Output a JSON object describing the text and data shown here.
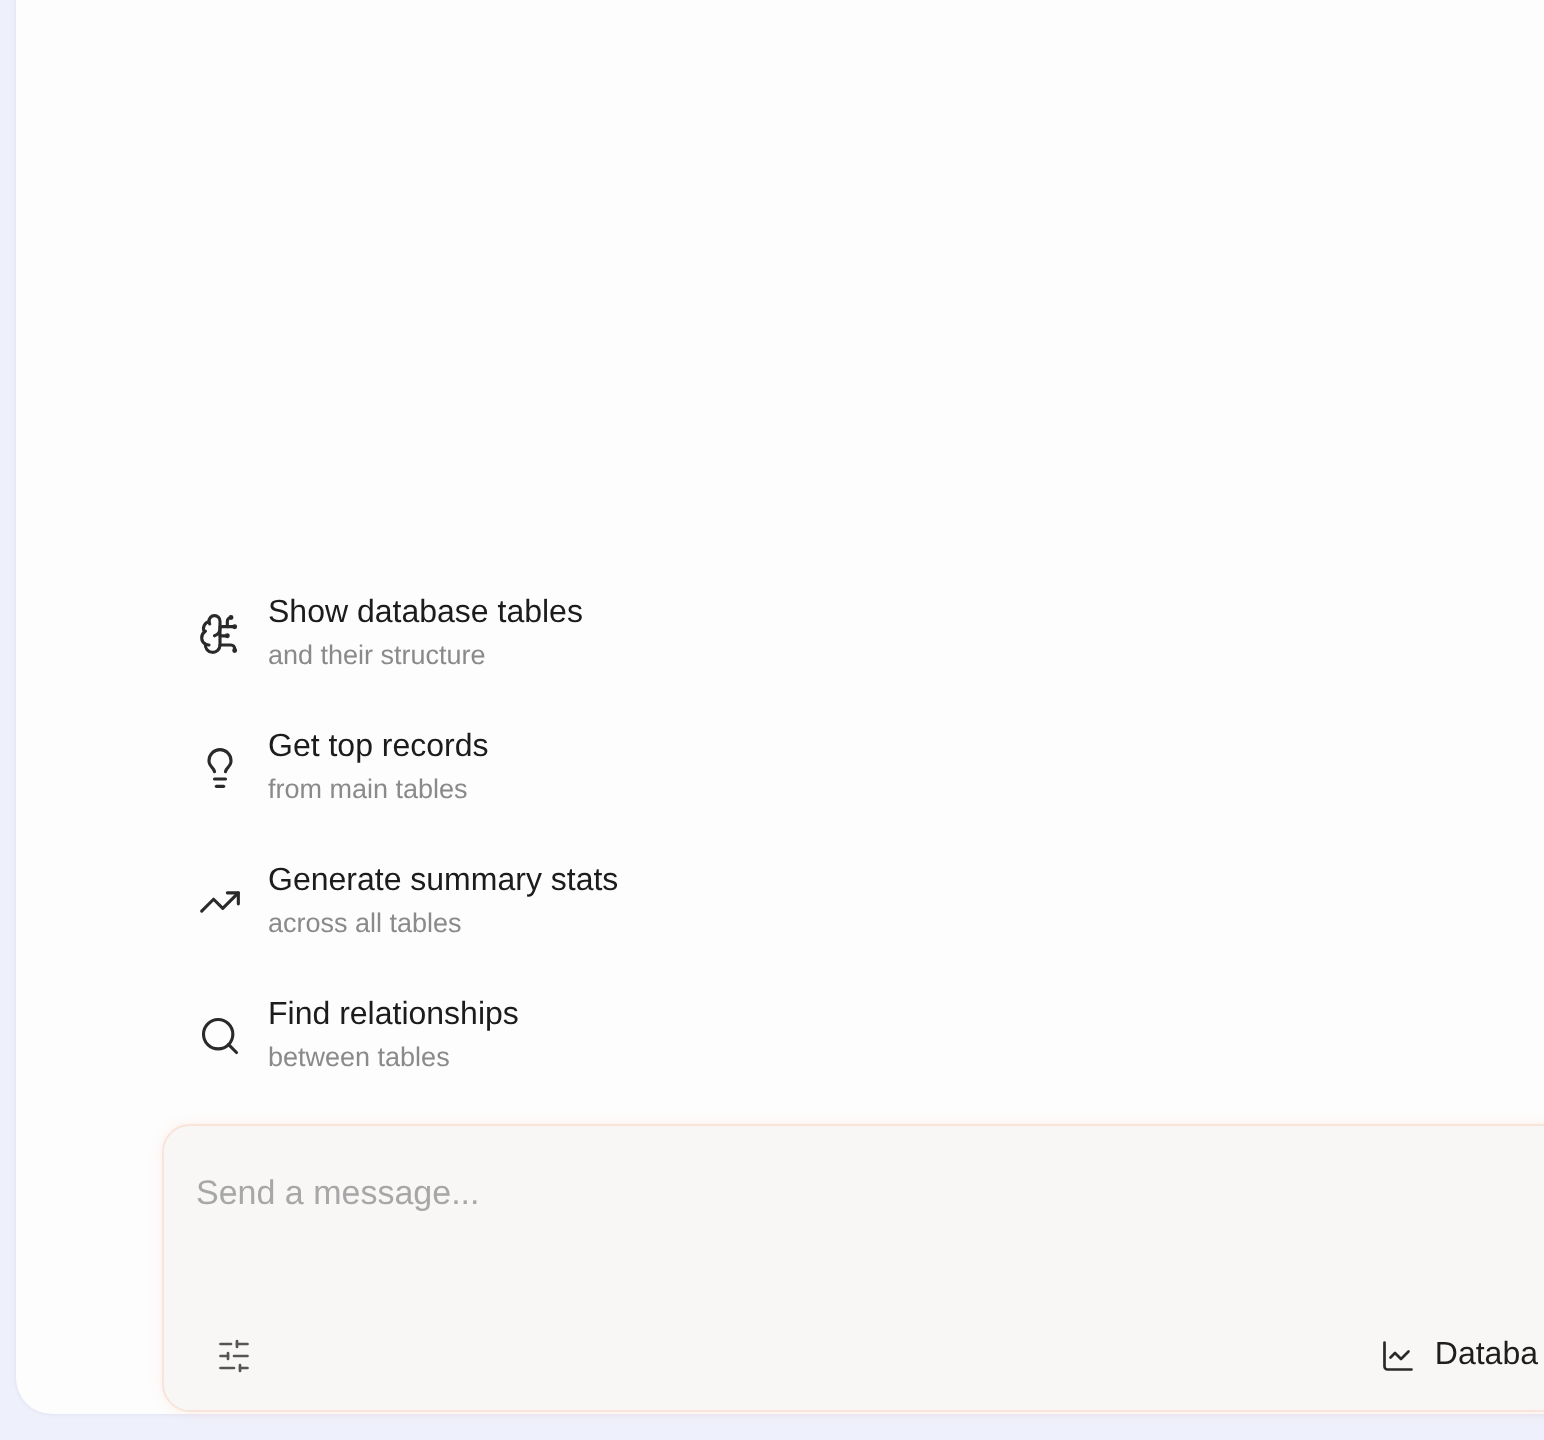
{
  "suggestions": [
    {
      "title": "Show database tables",
      "subtitle": "and their structure"
    },
    {
      "title": "Get top records",
      "subtitle": "from main tables"
    },
    {
      "title": "Generate summary stats",
      "subtitle": "across all tables"
    },
    {
      "title": "Find relationships",
      "subtitle": "between tables"
    }
  ],
  "composer": {
    "placeholder": "Send a message...",
    "mode_label": "Databa"
  }
}
